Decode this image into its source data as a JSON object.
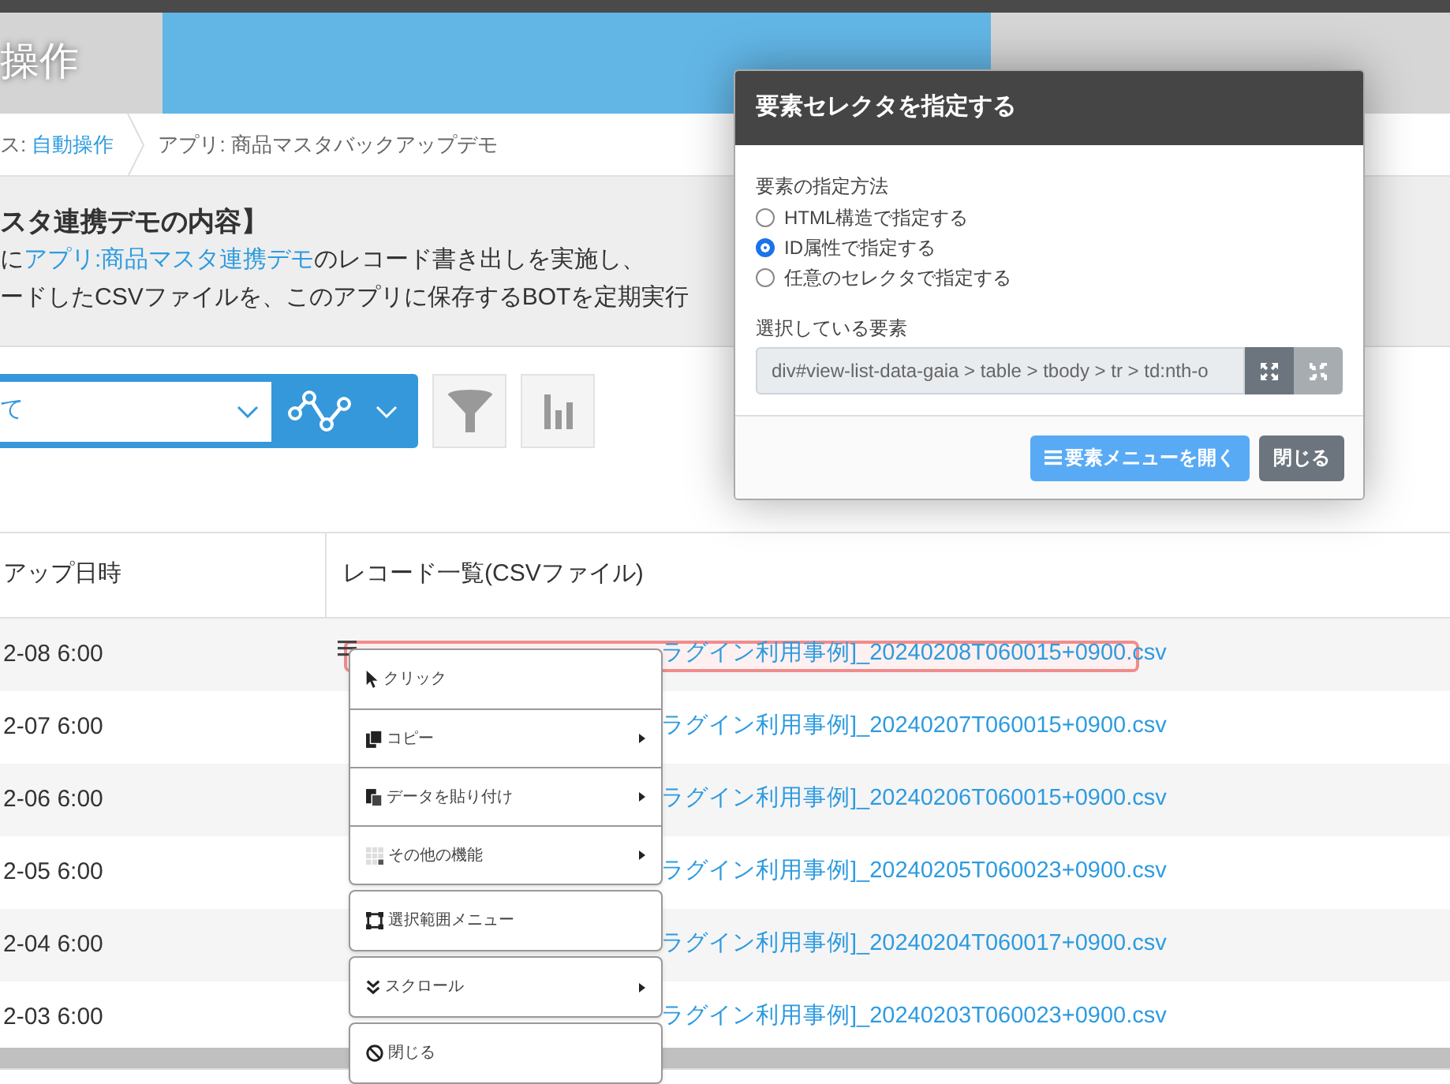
{
  "header": {
    "title": "操作"
  },
  "breadcrumb": [
    {
      "parts": [
        {
          "text": "ス: ",
          "link": false
        },
        {
          "text": "自動操作",
          "link": true
        }
      ]
    },
    {
      "parts": [
        {
          "text": "アプリ: 商品マスタバックアップデモ",
          "link": false
        }
      ]
    }
  ],
  "description": {
    "title": "スタ連携デモの内容】",
    "lines": [
      {
        "parts": [
          {
            "text": "に",
            "link": false
          },
          {
            "text": "アプリ:商品マスタ連携デモ",
            "link": true
          },
          {
            "text": "のレコード書き出しを実施し、",
            "link": false
          }
        ]
      },
      {
        "parts": [
          {
            "text": "ードしたCSVファイルを、このアプリに保存するBOTを定期実行",
            "link": false
          }
        ]
      }
    ]
  },
  "toolbar": {
    "view_select": "て"
  },
  "table": {
    "columns": [
      "アップ日時",
      "レコード一覧(CSVファイル)"
    ],
    "rows": [
      {
        "date": "2-08 6:00",
        "file": "ラグイン利用事例]_20240208T060015+0900.csv",
        "highlighted": true
      },
      {
        "date": "2-07 6:00",
        "file": "ラグイン利用事例]_20240207T060015+0900.csv",
        "highlighted": false
      },
      {
        "date": "2-06 6:00",
        "file": "ラグイン利用事例]_20240206T060015+0900.csv",
        "highlighted": false
      },
      {
        "date": "2-05 6:00",
        "file": "ラグイン利用事例]_20240205T060023+0900.csv",
        "highlighted": false
      },
      {
        "date": "2-04 6:00",
        "file": "ラグイン利用事例]_20240204T060017+0900.csv",
        "highlighted": false
      },
      {
        "date": "2-03 6:00",
        "file": "ラグイン利用事例]_20240203T060023+0900.csv",
        "highlighted": false
      }
    ]
  },
  "context_menu": {
    "groups": [
      [
        {
          "kind": "click",
          "label": "クリック",
          "submenu": false
        },
        {
          "kind": "copy",
          "label": "コピー",
          "submenu": true
        },
        {
          "kind": "paste",
          "label": "データを貼り付け",
          "submenu": true
        },
        {
          "kind": "other",
          "label": "その他の機能",
          "submenu": true
        }
      ],
      [
        {
          "kind": "selection",
          "label": "選択範囲メニュー",
          "submenu": false
        }
      ],
      [
        {
          "kind": "scroll",
          "label": "スクロール",
          "submenu": true
        }
      ],
      [
        {
          "kind": "close",
          "label": "閉じる",
          "submenu": false
        }
      ]
    ]
  },
  "modal": {
    "title": "要素セレクタを指定する",
    "method_label": "要素の指定方法",
    "options": [
      {
        "label": "HTML構造で指定する",
        "selected": false
      },
      {
        "label": "ID属性で指定する",
        "selected": true
      },
      {
        "label": "任意のセレクタで指定する",
        "selected": false
      }
    ],
    "selected_label": "選択している要素",
    "selector_value": "div#view-list-data-gaia > table > tbody > tr > td:nth-o",
    "buttons": [
      {
        "kind": "primary",
        "label": "要素メニューを開く"
      },
      {
        "kind": "secondary",
        "label": "閉じる"
      }
    ]
  }
}
